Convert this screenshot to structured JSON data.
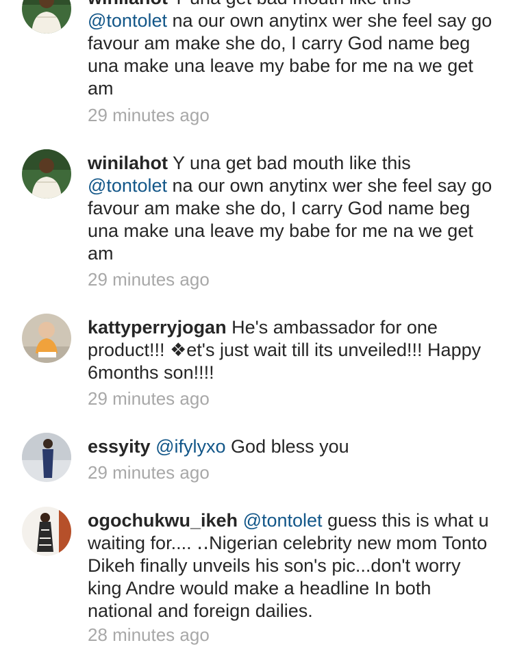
{
  "comments": [
    {
      "username": "winilahot",
      "text_before": "Y una get bad mouth like this",
      "mention": "@tontolet",
      "text_after": "na our own anytinx wer she feel say go favour am make she do, I carry God name beg una make una leave my babe for me na we get am",
      "timestamp": "29 minutes ago",
      "avatar_icon": "avatar-woman-white-top"
    },
    {
      "username": "winilahot",
      "text_before": "Y una get bad mouth like this",
      "mention": "@tontolet",
      "text_after": "na our own anytinx wer she feel say go favour am make she do, I carry God name beg una make una leave my babe for me na we get am",
      "timestamp": "29 minutes ago",
      "avatar_icon": "avatar-woman-white-top"
    },
    {
      "username": "kattyperryjogan",
      "text_before": "He's ambassador for one product!!! ❖et's just wait till its unveiled!!! Happy 6months son!!!!",
      "mention": "",
      "text_after": "",
      "timestamp": "29 minutes ago",
      "avatar_icon": "avatar-baby"
    },
    {
      "username": "essyity",
      "text_before": "",
      "mention": "@ifylyxo",
      "text_after": "God bless you",
      "timestamp": "29 minutes ago",
      "avatar_icon": "avatar-person-outdoor"
    },
    {
      "username": "ogochukwu_ikeh",
      "text_before": "",
      "mention": "@tontolet",
      "text_after": " guess this is what u waiting for.... ‥Nigerian celebrity new mom Tonto Dikeh finally unveils his son's pic...don't worry king Andre would make a headline In both national and foreign dailies.",
      "timestamp": "28 minutes ago",
      "avatar_icon": "avatar-woman-dress"
    }
  ],
  "colors": {
    "text": "#262626",
    "mention": "#125688",
    "timestamp": "#a8a8a8"
  }
}
